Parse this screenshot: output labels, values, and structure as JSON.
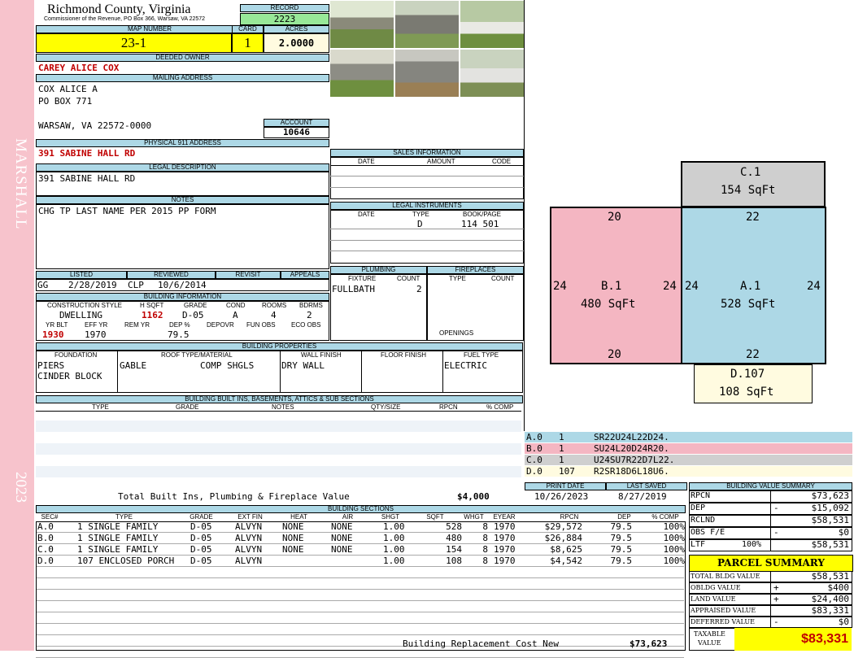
{
  "side_top": "MARSHALL",
  "side_bottom": "2023",
  "county": "Richmond County, Virginia",
  "commissioner": "Commissioner of the Revenue, PO Box 366, Warsaw, VA 22572",
  "record_label": "RECORD",
  "record": "2223",
  "map_label": "MAP NUMBER",
  "map": "23-1",
  "card_label": "CARD",
  "card": "1",
  "acres_label": "ACRES",
  "acres": "2.0000",
  "owner_label": "DEEDED OWNER",
  "owner": "CAREY ALICE COX",
  "mailing_label": "MAILING ADDRESS",
  "mailing": [
    "COX ALICE A",
    "PO BOX 771",
    "",
    "WARSAW, VA 22572-0000"
  ],
  "account_label": "ACCOUNT",
  "account": "10646",
  "phys_label": "PHYSICAL 911 ADDRESS",
  "phys": "391 SABINE HALL RD",
  "legal_label": "LEGAL DESCRIPTION",
  "legal": "391 SABINE HALL RD",
  "notes_label": "NOTES",
  "notes": "CHG TP LAST NAME PER 2015 PP FORM",
  "sales": {
    "label": "SALES INFORMATION",
    "cols": [
      "DATE",
      "AMOUNT",
      "CODE"
    ]
  },
  "instr": {
    "label": "LEGAL INSTRUMENTS",
    "cols": [
      "DATE",
      "TYPE",
      "BOOK/PAGE"
    ],
    "type": "D",
    "book": "114 501"
  },
  "listed": {
    "listed_label": "LISTED",
    "reviewed_label": "REVIEWED",
    "revisit_label": "REVISIT",
    "appeals_label": "APPEALS",
    "lby": "GG",
    "ldate": "2/28/2019",
    "rby": "CLP",
    "rdate": "10/6/2014"
  },
  "plumbing": {
    "label": "PLUMBING",
    "fixture_label": "FIXTURE",
    "count_label": "COUNT",
    "fixture": "FULLBATH",
    "count": "2"
  },
  "fireplaces": {
    "label": "FIREPLACES",
    "type_label": "TYPE",
    "count_label": "COUNT",
    "openings": "OPENINGS"
  },
  "bldg": {
    "label": "BUILDING INFORMATION",
    "cs_label": "CONSTRUCTION STYLE",
    "hsqft_label": "H SQFT",
    "grade_label": "GRADE",
    "cond_label": "COND",
    "rooms_label": "ROOMS",
    "bdrms_label": "BDRMS",
    "cs": "DWELLING",
    "hsqft": "1162",
    "grade": "D-05",
    "cond": "A",
    "rooms": "4",
    "bdrms": "2",
    "yrblt_label": "YR BLT",
    "effyr_label": "EFF YR",
    "remyr_label": "REM YR",
    "dep_label": "DEP %",
    "depovr_label": "DEPOVR",
    "funobs_label": "FUN OBS",
    "ecoobs_label": "ECO OBS",
    "yrblt": "1930",
    "effyr": "1970",
    "dep": "79.5"
  },
  "props": {
    "label": "BUILDING PROPERTIES",
    "foundation_label": "FOUNDATION",
    "roof_label": "ROOF TYPE/MATERIAL",
    "wall_label": "WALL FINISH",
    "floor_label": "FLOOR FINISH",
    "fuel_label": "FUEL TYPE",
    "found1": "PIERS",
    "found2": "CINDER BLOCK",
    "roof1": "GABLE",
    "roof2": "COMP SHGLS",
    "wall": "DRY WALL",
    "fuel": "ELECTRIC"
  },
  "builtins": {
    "label": "BUILDING BUILT INS, BASEMENTS, ATTICS & SUB SECTIONS",
    "cols": [
      "TYPE",
      "GRADE",
      "NOTES",
      "QTY/SIZE",
      "RPCN",
      "% COMP"
    ],
    "total_label": "Total Built Ins, Plumbing & Fireplace Value",
    "total": "$4,000"
  },
  "sections": {
    "label": "BUILDING SECTIONS",
    "cols": [
      "SEC#",
      "TYPE",
      "GRADE",
      "EXT FIN",
      "HEAT",
      "AIR",
      "SHGT",
      "SQFT",
      "WHGT",
      "EYEAR",
      "RPCN",
      "DEP",
      "% COMP"
    ],
    "rows": [
      [
        "A.0",
        "1 SINGLE FAMILY",
        "D-05",
        "ALVYN",
        "NONE",
        "NONE",
        "1.00",
        "528",
        "8",
        "1970",
        "$29,572",
        "79.5",
        "100%"
      ],
      [
        "B.0",
        "1 SINGLE FAMILY",
        "D-05",
        "ALVYN",
        "NONE",
        "NONE",
        "1.00",
        "480",
        "8",
        "1970",
        "$26,884",
        "79.5",
        "100%"
      ],
      [
        "C.0",
        "1 SINGLE FAMILY",
        "D-05",
        "ALVYN",
        "NONE",
        "NONE",
        "1.00",
        "154",
        "8",
        "1970",
        "$8,625",
        "79.5",
        "100%"
      ],
      [
        "D.0",
        "107 ENCLOSED PORCH",
        "D-05",
        "ALVYN",
        "",
        "",
        "1.00",
        "108",
        "8",
        "1970",
        "$4,542",
        "79.5",
        "100%"
      ]
    ],
    "replacement_label": "Building Replacement Cost New",
    "replacement": "$73,623"
  },
  "sketch": {
    "C": {
      "name": "C.1",
      "area": "154 SqFt"
    },
    "B": {
      "name": "B.1",
      "area": "480 SqFt",
      "top": "20",
      "bottom": "20",
      "left": "24",
      "right": "24"
    },
    "A": {
      "name": "A.1",
      "area": "528 SqFt",
      "top": "22",
      "bottom": "22",
      "left": "24",
      "right": "24"
    },
    "D": {
      "name": "D.107",
      "area": "108 SqFt"
    },
    "colors": {
      "A": "#add8e6",
      "B": "#f4b6c2",
      "C": "#cfcfcf",
      "D": "#fffbe0"
    }
  },
  "traces": [
    {
      "sec": "A.0",
      "n": "1",
      "code": "SR22U24L22D24.",
      "color": "#add8e6"
    },
    {
      "sec": "B.0",
      "n": "1",
      "code": "SU24L20D24R20.",
      "color": "#f4b6c2"
    },
    {
      "sec": "C.0",
      "n": "1",
      "code": "U24SU7R22D7L22.",
      "color": "#cfcfcf"
    },
    {
      "sec": "D.0",
      "n": "107",
      "code": "R2SR18D6L18U6.",
      "color": "#fffbe0"
    }
  ],
  "dates": {
    "print_label": "PRINT DATE",
    "print": "10/26/2023",
    "saved_label": "LAST SAVED",
    "saved": "8/27/2019"
  },
  "bvs": {
    "label": "BUILDING VALUE SUMMARY",
    "rows": [
      {
        "k": "RPCN",
        "s": "",
        "v": "$73,623"
      },
      {
        "k": "DEP",
        "s": "-",
        "v": "$15,092"
      },
      {
        "k": "RCLND",
        "s": "",
        "v": "$58,531"
      },
      {
        "k": "OBS F/E",
        "s": "-",
        "v": "$0"
      },
      {
        "k": "LTF",
        "p": "100%",
        "s": "",
        "v": "$58,531"
      }
    ]
  },
  "parcel": {
    "label": "PARCEL SUMMARY",
    "rows": [
      {
        "k": "TOTAL BLDG VALUE",
        "s": "",
        "v": "$58,531"
      },
      {
        "k": "OBLDG VALUE",
        "s": "+",
        "v": "$400"
      },
      {
        "k": "LAND VALUE",
        "s": "+",
        "v": "$24,400"
      },
      {
        "k": "APPRAISED VALUE",
        "s": "",
        "v": "$83,331"
      },
      {
        "k": "DEFERRED VALUE",
        "s": "-",
        "v": "$0"
      }
    ],
    "taxable_label1": "TAXABLE",
    "taxable_label2": "VALUE",
    "taxable": "$83,331"
  },
  "photos": [
    "shed photo 1",
    "shed photo 2",
    "house photo 1",
    "shed photo 3",
    "shed photo 4",
    "house photo 2"
  ]
}
